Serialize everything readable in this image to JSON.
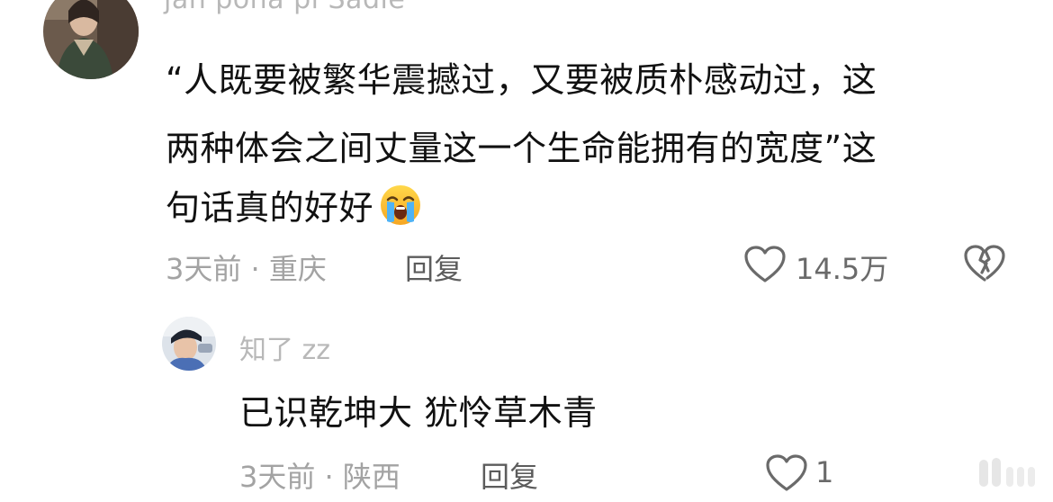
{
  "comment": {
    "username": "jan pona pi Sadie",
    "lines": [
      "“人既要被繁华震撼过，又要被质朴感动过，这",
      "两种体会之间丈量这一个生命能拥有的宽度”这",
      "句话真的好好"
    ],
    "emoji": "loudly-crying-face-emoji",
    "time": "3天前",
    "location": "重庆",
    "meta_sep": " · ",
    "reply_label": "回复",
    "likes": "14.5万",
    "colors": {
      "text": "#111111",
      "muted": "#a3a3a3",
      "username": "#b8b8b8"
    }
  },
  "reply": {
    "username": "知了 zz",
    "text": "已识乾坤大 犹怜草木青",
    "time": "3天前",
    "location": "陕西",
    "meta_sep": " · ",
    "reply_label": "回复",
    "likes": "1"
  },
  "icons": {
    "like": "heart-outline-icon",
    "dislike": "broken-heart-icon"
  }
}
